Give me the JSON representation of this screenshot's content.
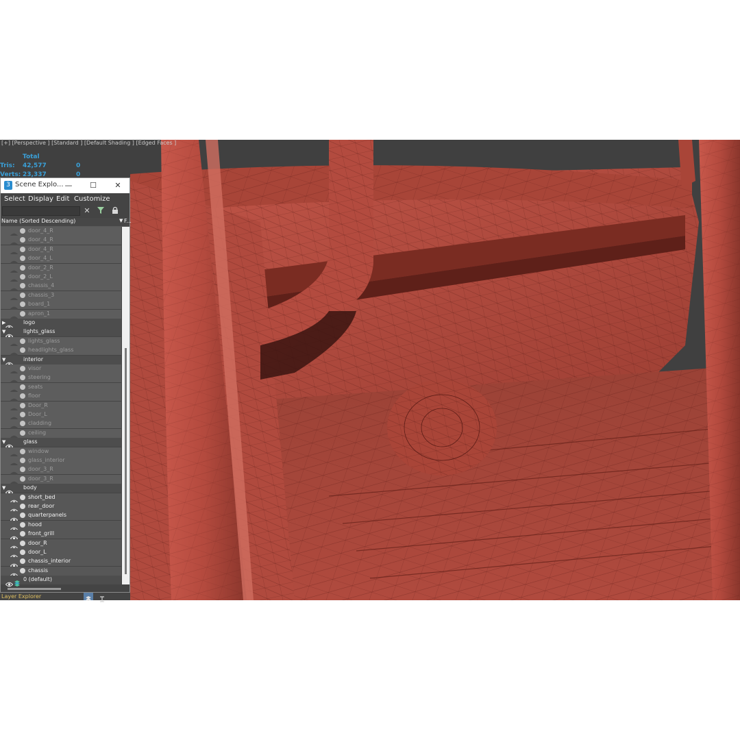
{
  "viewport": {
    "label": "[+] [Perspective ] [Standard ] [Default Shading ] [Edged Faces ]",
    "stats": {
      "header": "Total",
      "rows": [
        {
          "label": "Tris:",
          "total": "42,577",
          "selected": "0"
        },
        {
          "label": "Verts:",
          "total": "23,337",
          "selected": "0"
        }
      ]
    },
    "model_color": "#b4483c",
    "background_color": "#404040"
  },
  "explorer": {
    "title": "Scene Explo...",
    "menu": [
      "Select",
      "Display",
      "Edit",
      "Customize"
    ],
    "column_header": "Name (Sorted Descending)",
    "column_f": "F...",
    "rows": [
      {
        "name": "door_4_R",
        "type": "object",
        "dim": true
      },
      {
        "name": "door_4_R",
        "type": "object",
        "dim": true
      },
      {
        "name": "door_4_R",
        "type": "object",
        "dim": true
      },
      {
        "name": "door_4_L",
        "type": "object",
        "dim": true
      },
      {
        "name": "door_2_R",
        "type": "object",
        "dim": true
      },
      {
        "name": "door_2_L",
        "type": "object",
        "dim": true
      },
      {
        "name": "chassis_4",
        "type": "object",
        "dim": true
      },
      {
        "name": "chassis_3",
        "type": "object",
        "dim": true
      },
      {
        "name": "board_1",
        "type": "object",
        "dim": true
      },
      {
        "name": "apron_1",
        "type": "object",
        "dim": true
      },
      {
        "name": "logo",
        "type": "layer",
        "expanded": false
      },
      {
        "name": "lights_glass",
        "type": "layer",
        "expanded": true
      },
      {
        "name": "lights_glass",
        "type": "object",
        "dim": true
      },
      {
        "name": "headlights_glass",
        "type": "object",
        "dim": true
      },
      {
        "name": "interior",
        "type": "layer",
        "expanded": true
      },
      {
        "name": "visor",
        "type": "object",
        "dim": true
      },
      {
        "name": "steering",
        "type": "object",
        "dim": true
      },
      {
        "name": "seats",
        "type": "object",
        "dim": true
      },
      {
        "name": "floor",
        "type": "object",
        "dim": true
      },
      {
        "name": "Door_R",
        "type": "object",
        "dim": true
      },
      {
        "name": "Door_L",
        "type": "object",
        "dim": true
      },
      {
        "name": "cladding",
        "type": "object",
        "dim": true
      },
      {
        "name": "ceiling",
        "type": "object",
        "dim": true
      },
      {
        "name": "glass",
        "type": "layer",
        "expanded": true
      },
      {
        "name": "window",
        "type": "object",
        "dim": true
      },
      {
        "name": "glass_interior",
        "type": "object",
        "dim": true
      },
      {
        "name": "door_3_R",
        "type": "object",
        "dim": true
      },
      {
        "name": "door_3_R",
        "type": "object",
        "dim": true
      },
      {
        "name": "body",
        "type": "layer",
        "expanded": true
      },
      {
        "name": "short_bed",
        "type": "object",
        "dim": false
      },
      {
        "name": "rear_door",
        "type": "object",
        "dim": false
      },
      {
        "name": "quarterpanels",
        "type": "object",
        "dim": false
      },
      {
        "name": "hood",
        "type": "object",
        "dim": false
      },
      {
        "name": "front_grill",
        "type": "object",
        "dim": false
      },
      {
        "name": "door_R",
        "type": "object",
        "dim": false
      },
      {
        "name": "door_L",
        "type": "object",
        "dim": false
      },
      {
        "name": "chassis_interior",
        "type": "object",
        "dim": false
      },
      {
        "name": "chassis",
        "type": "object",
        "dim": false
      },
      {
        "name": "0 (default)",
        "type": "default-layer"
      }
    ],
    "bottom_label": "Layer Explorer"
  }
}
